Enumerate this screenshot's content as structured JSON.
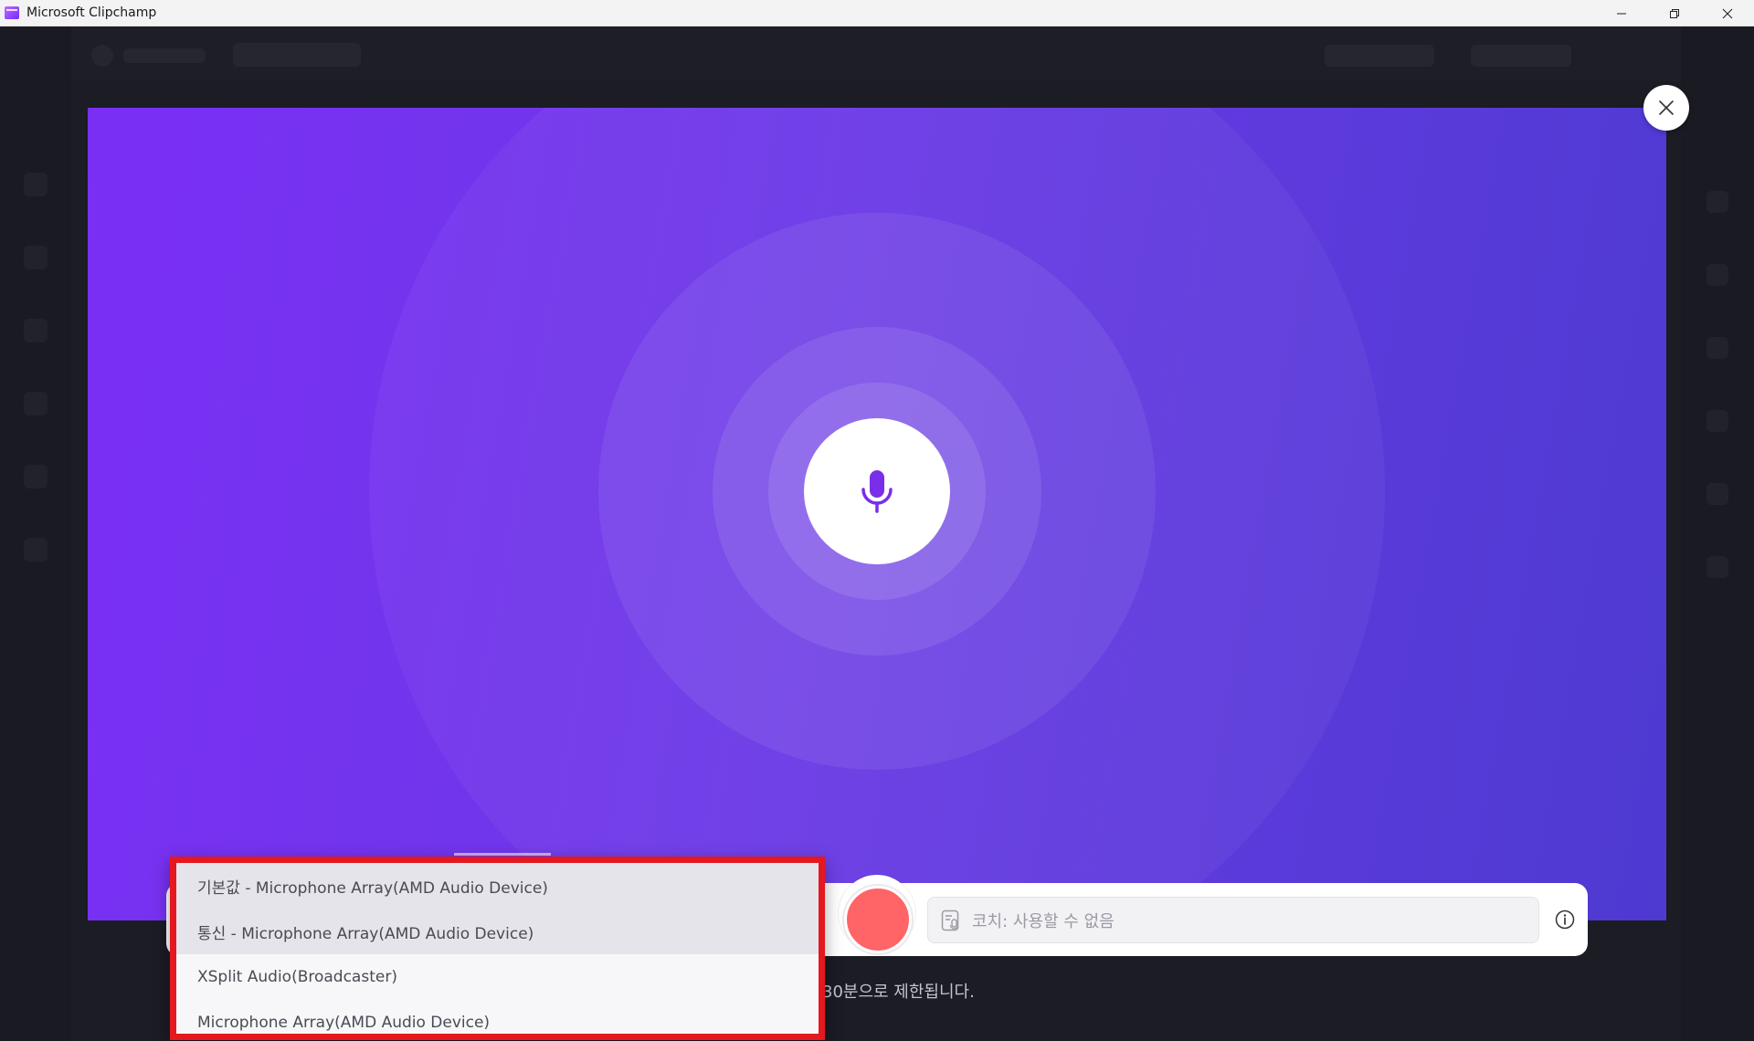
{
  "window": {
    "title": "Microsoft Clipchamp"
  },
  "recorder": {
    "coach_placeholder": "코치: 사용할 수 없음",
    "limit_note": "30분으로 제한됩니다."
  },
  "microphone_menu": {
    "options": [
      {
        "label": "기본값 - Microphone Array(AMD Audio Device)"
      },
      {
        "label": "통신 - Microphone Array(AMD Audio Device)"
      },
      {
        "label": "XSplit Audio(Broadcaster)"
      },
      {
        "label": "Microphone Array(AMD Audio Device)"
      }
    ]
  },
  "colors": {
    "stage_start": "#7b2ff5",
    "stage_end": "#4d3ad1",
    "record": "#ff6466",
    "highlight_border": "#e5171f",
    "mic_icon": "#7a2ee8"
  },
  "icons": {
    "app": "clipchamp-logo-icon",
    "minimize": "minimize-icon",
    "restore": "restore-icon",
    "close_window": "close-window-icon",
    "close_dialog": "close-icon",
    "mic": "microphone-icon",
    "coach": "speaker-coach-icon",
    "info": "info-icon"
  }
}
